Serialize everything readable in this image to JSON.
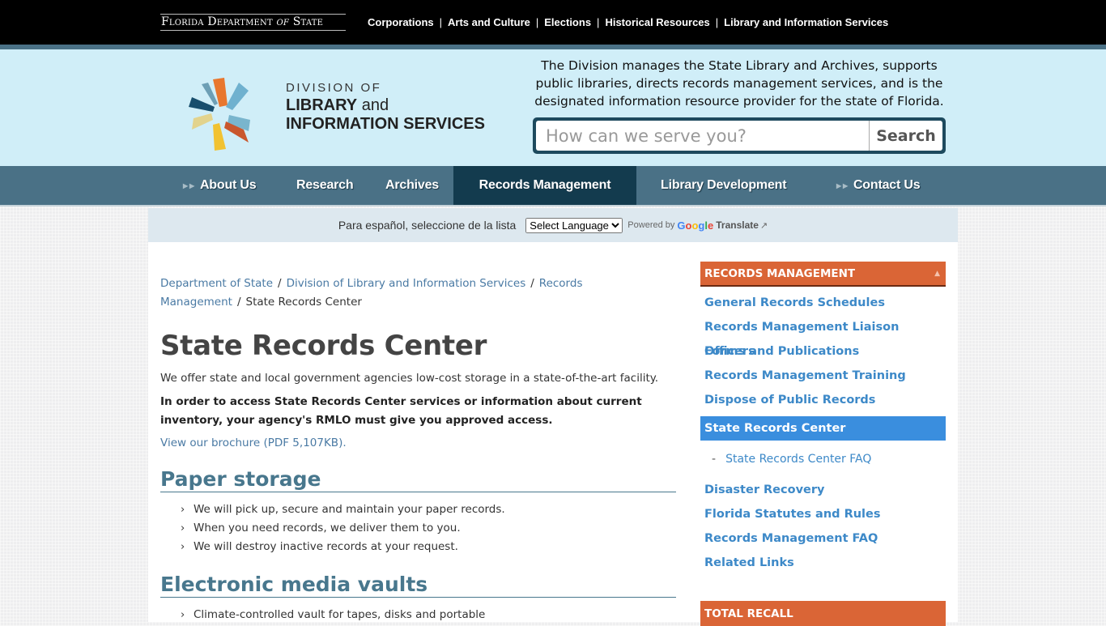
{
  "topbar": {
    "brand": {
      "part1": "Florida Department ",
      "of": "of",
      "part2": " State"
    },
    "links": [
      "Corporations",
      "Arts and Culture",
      "Elections",
      "Historical Resources",
      "Library and Information Services"
    ],
    "separator": "|"
  },
  "header": {
    "logo": {
      "line1": "DIVISION OF",
      "line2_bold": "LIBRARY",
      "line2_light": " and",
      "line3": "INFORMATION SERVICES"
    },
    "tagline": "The Division manages the State Library and Archives, supports public libraries, directs records management services, and is the designated information resource provider for the state of Florida.",
    "search": {
      "placeholder": "How can we serve you?",
      "value": "",
      "button": "Search"
    }
  },
  "nav": {
    "items": [
      {
        "label": "About Us",
        "has_arrow": true
      },
      {
        "label": "Research"
      },
      {
        "label": "Archives"
      },
      {
        "label": "Records Management",
        "active": true
      },
      {
        "label": "Library Development"
      },
      {
        "label": "Contact Us",
        "has_arrow": true
      }
    ]
  },
  "translate": {
    "prompt": "Para español, seleccione de la lista",
    "select_value": "Select Language",
    "powered_by": "Powered by",
    "google": [
      "G",
      "o",
      "o",
      "g",
      "l",
      "e"
    ],
    "translate": "Translate",
    "external_icon": "↗"
  },
  "breadcrumb": {
    "items": [
      "Department of State",
      "Division of Library and Information Services",
      "Records",
      "Management"
    ],
    "current": "State Records Center",
    "separator": "/"
  },
  "content": {
    "title": "State Records Center",
    "intro": "We offer state and local government agencies low-cost storage in a state-of-the-art facility.",
    "notice": "In order to access State Records Center services or information about current inventory, your agency's RMLO must give you approved access.",
    "brochure_link": "View our brochure (PDF 5,107KB).",
    "sections": [
      {
        "heading": "Paper storage",
        "bullets": [
          "We will pick up, secure and maintain your paper records.",
          "When you need records, we deliver them to you.",
          "We will destroy inactive records at your request."
        ]
      },
      {
        "heading": "Electronic media vaults",
        "bullets": [
          "Climate-controlled vault for tapes, disks and portable"
        ]
      }
    ]
  },
  "sidebar": {
    "heading": "RECORDS MANAGEMENT",
    "links": [
      "General Records Schedules",
      "Records Management Liaison Officers",
      "Forms and Publications",
      "Records Management Training",
      "Dispose of Public Records"
    ],
    "active": "State Records Center",
    "sub_links": [
      "State Records Center FAQ"
    ],
    "links_after": [
      "Disaster Recovery",
      "Florida Statutes and Rules",
      "Records Management FAQ",
      "Related Links"
    ],
    "second_heading": "TOTAL RECALL"
  },
  "colors": {
    "topbar": "#000000",
    "header_bg": "#d0eef8",
    "nav_bg": "#4a7186",
    "nav_active": "#133b4e",
    "sidebar_heading": "#da6536",
    "sidebar_active": "#3a8ede",
    "link": "#3d89c8",
    "heading2": "#48778d"
  }
}
